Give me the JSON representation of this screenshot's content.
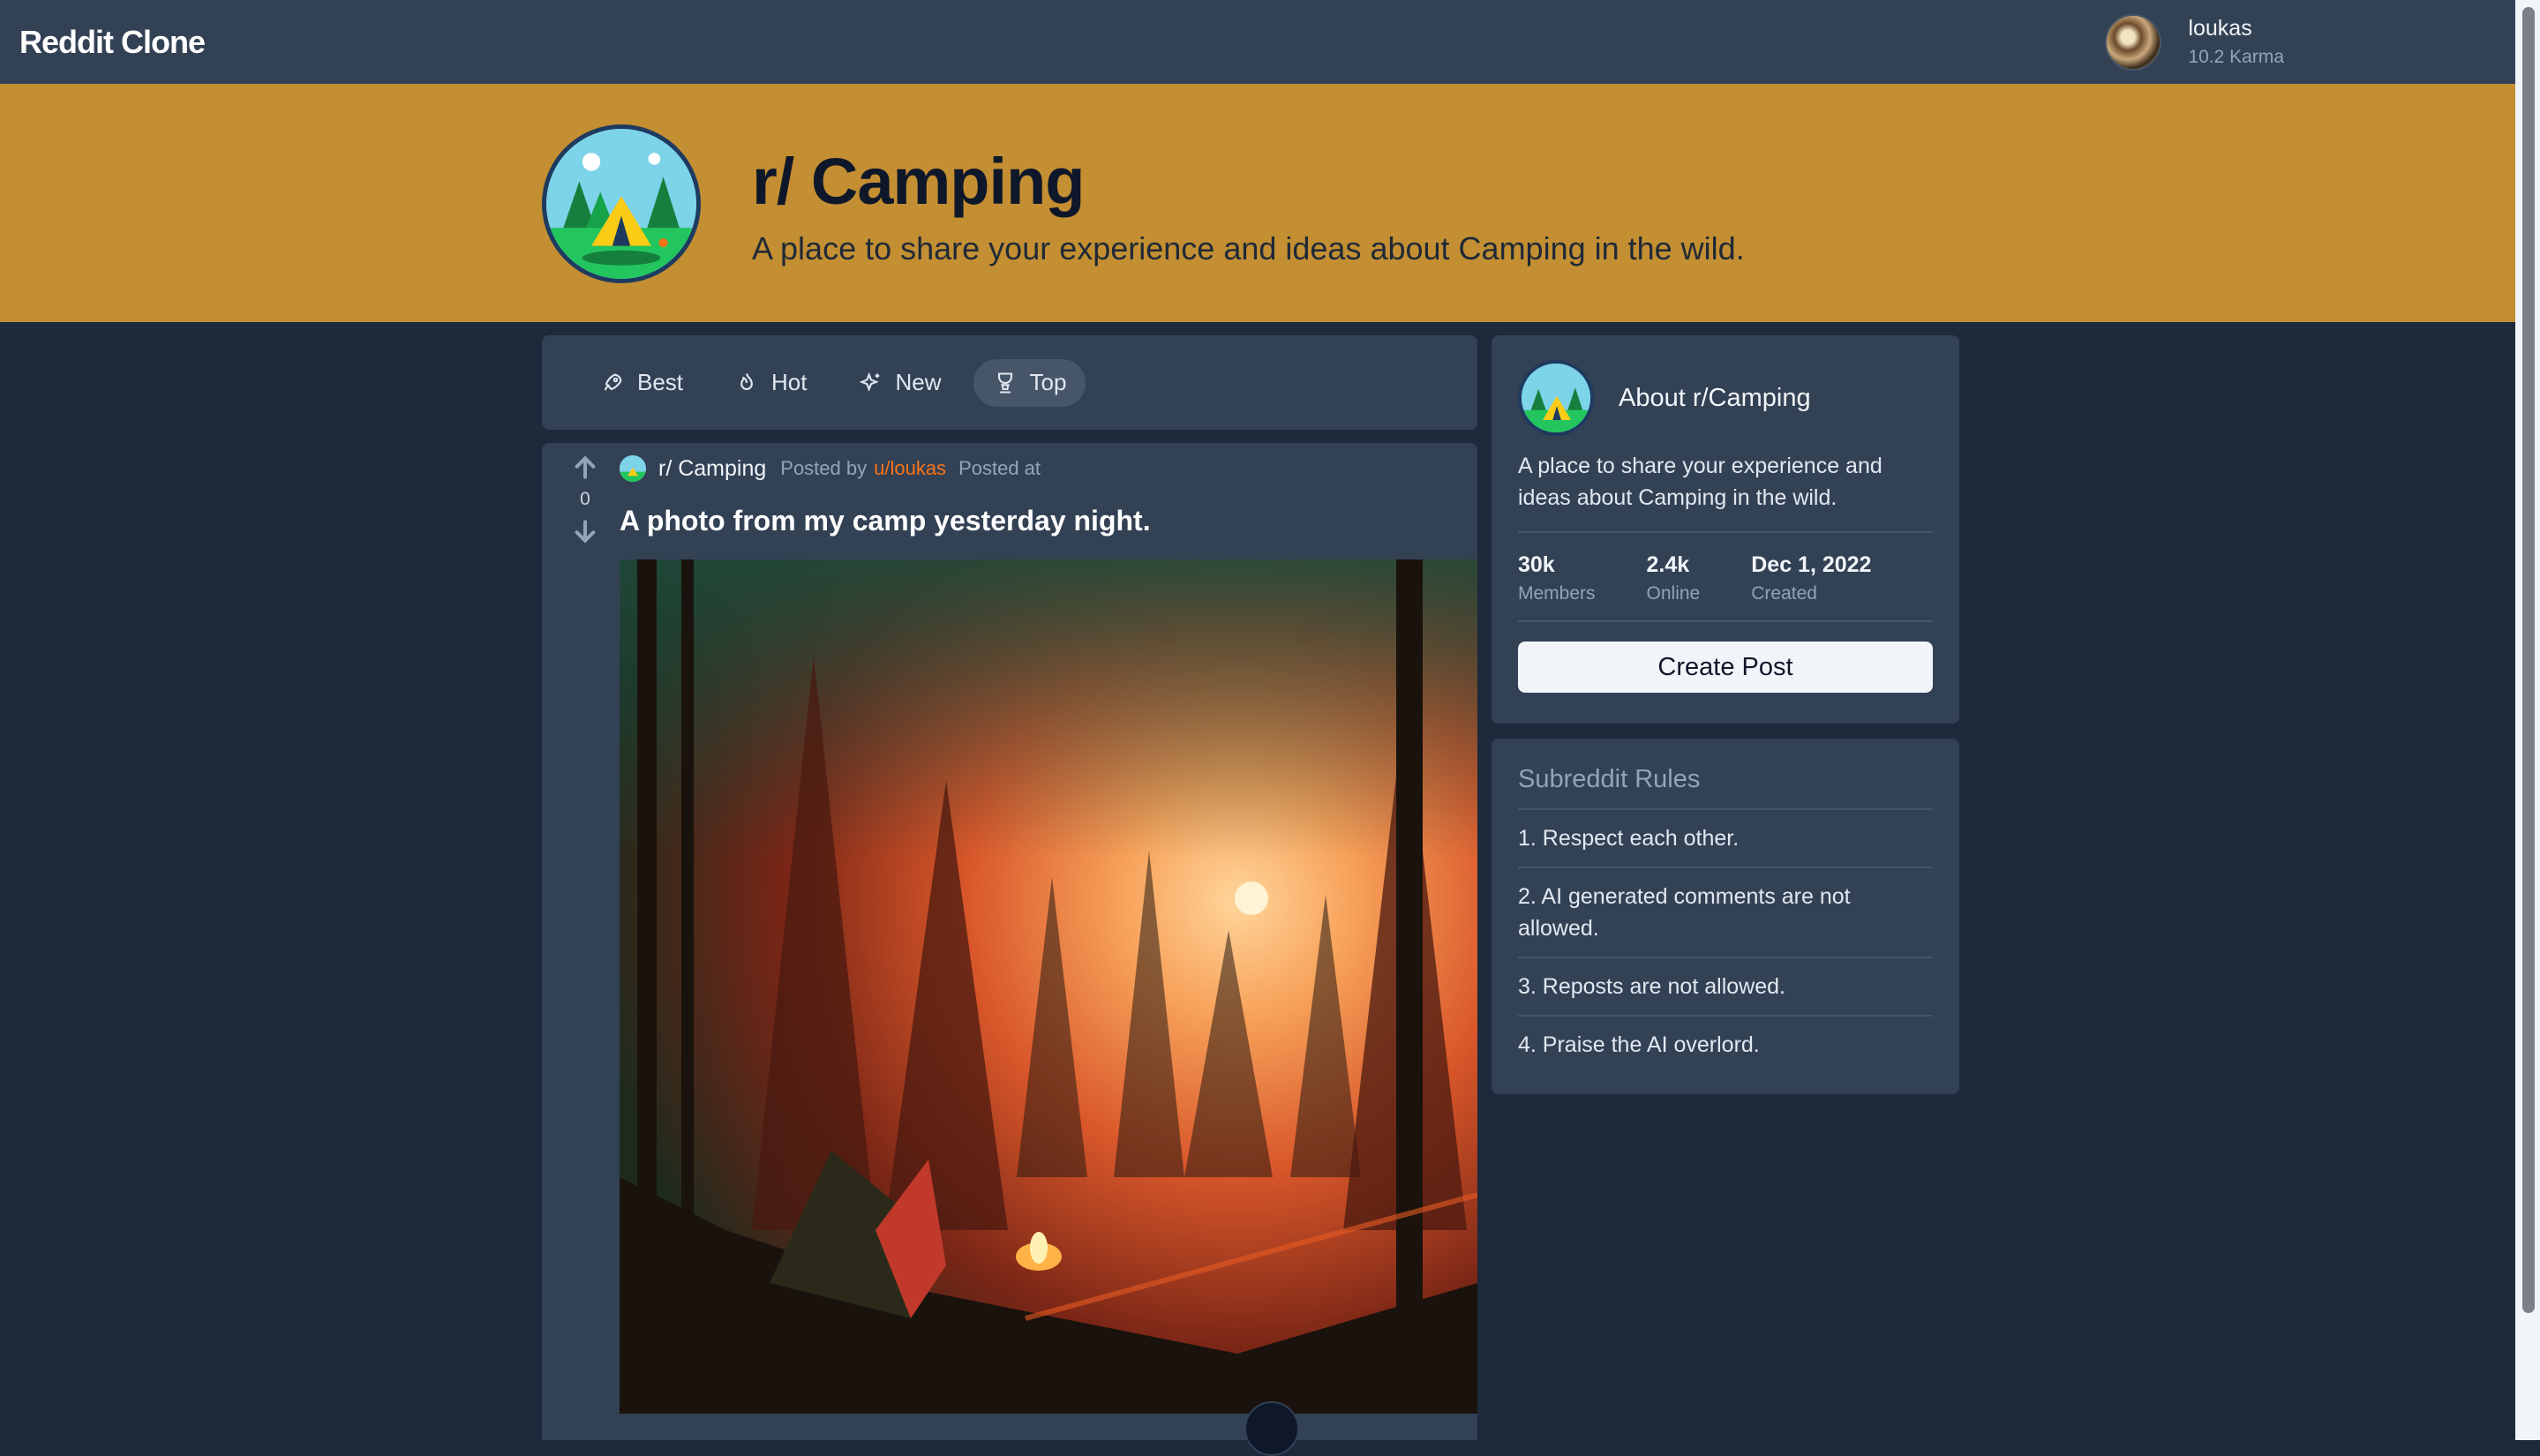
{
  "navbar": {
    "brand": "Reddit Clone",
    "user": {
      "name": "loukas",
      "karma": "10.2 Karma"
    }
  },
  "banner": {
    "title": "r/ Camping",
    "description": "A place to share your experience and ideas about Camping in the wild.",
    "color": "#c38f32"
  },
  "sort": {
    "options": [
      {
        "label": "Best",
        "icon": "rocket-icon"
      },
      {
        "label": "Hot",
        "icon": "flame-icon"
      },
      {
        "label": "New",
        "icon": "sparkles-icon"
      },
      {
        "label": "Top",
        "icon": "trophy-icon",
        "active": true
      }
    ]
  },
  "post": {
    "votes": "0",
    "subreddit": "r/ Camping",
    "posted_by": "Posted by",
    "author": "u/loukas",
    "posted_at": "Posted at",
    "title": "A photo from my camp yesterday night."
  },
  "about": {
    "title": "About r/Camping",
    "description": "A place to share your experience and ideas about Camping in the wild.",
    "stats": [
      {
        "value": "30k",
        "label": "Members"
      },
      {
        "value": "2.4k",
        "label": "Online"
      },
      {
        "value": "Dec 1, 2022",
        "label": "Created"
      }
    ],
    "create_post": "Create Post"
  },
  "rules": {
    "title": "Subreddit Rules",
    "items": [
      "1. Respect each other.",
      "2. AI generated comments are not allowed.",
      "3. Reposts are not allowed.",
      "4. Praise the AI overlord."
    ]
  },
  "colors": {
    "navbar": "#334155",
    "background": "#1e293b",
    "accent_user": "#f97316"
  }
}
